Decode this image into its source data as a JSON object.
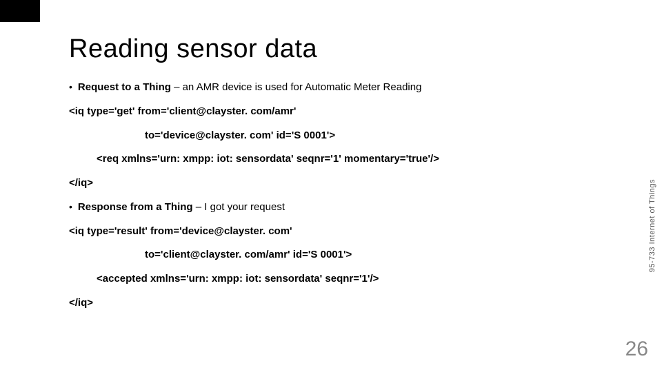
{
  "title": "Reading sensor data",
  "bullet1": {
    "label": "Request to a Thing",
    "desc": " – an AMR device is used for Automatic Meter Reading"
  },
  "code1": {
    "line1": "<iq type='get' from='client@clayster. com/amr'",
    "line2": "to='device@clayster. com' id='S 0001'>",
    "line3": "<req xmlns='urn: xmpp: iot: sensordata' seqnr='1' momentary='true'/>",
    "line4": "</iq>"
  },
  "bullet2": {
    "label": "Response from a Thing",
    "desc": " – I got your request"
  },
  "code2": {
    "line1": "<iq type='result' from='device@clayster. com'",
    "line2": "to='client@clayster. com/amr' id='S 0001'>",
    "line3": "<accepted xmlns='urn: xmpp: iot: sensordata' seqnr='1'/>",
    "line4": "</iq>"
  },
  "side_label": "95-733 Internet of Things",
  "page_number": "26",
  "dot": "•"
}
